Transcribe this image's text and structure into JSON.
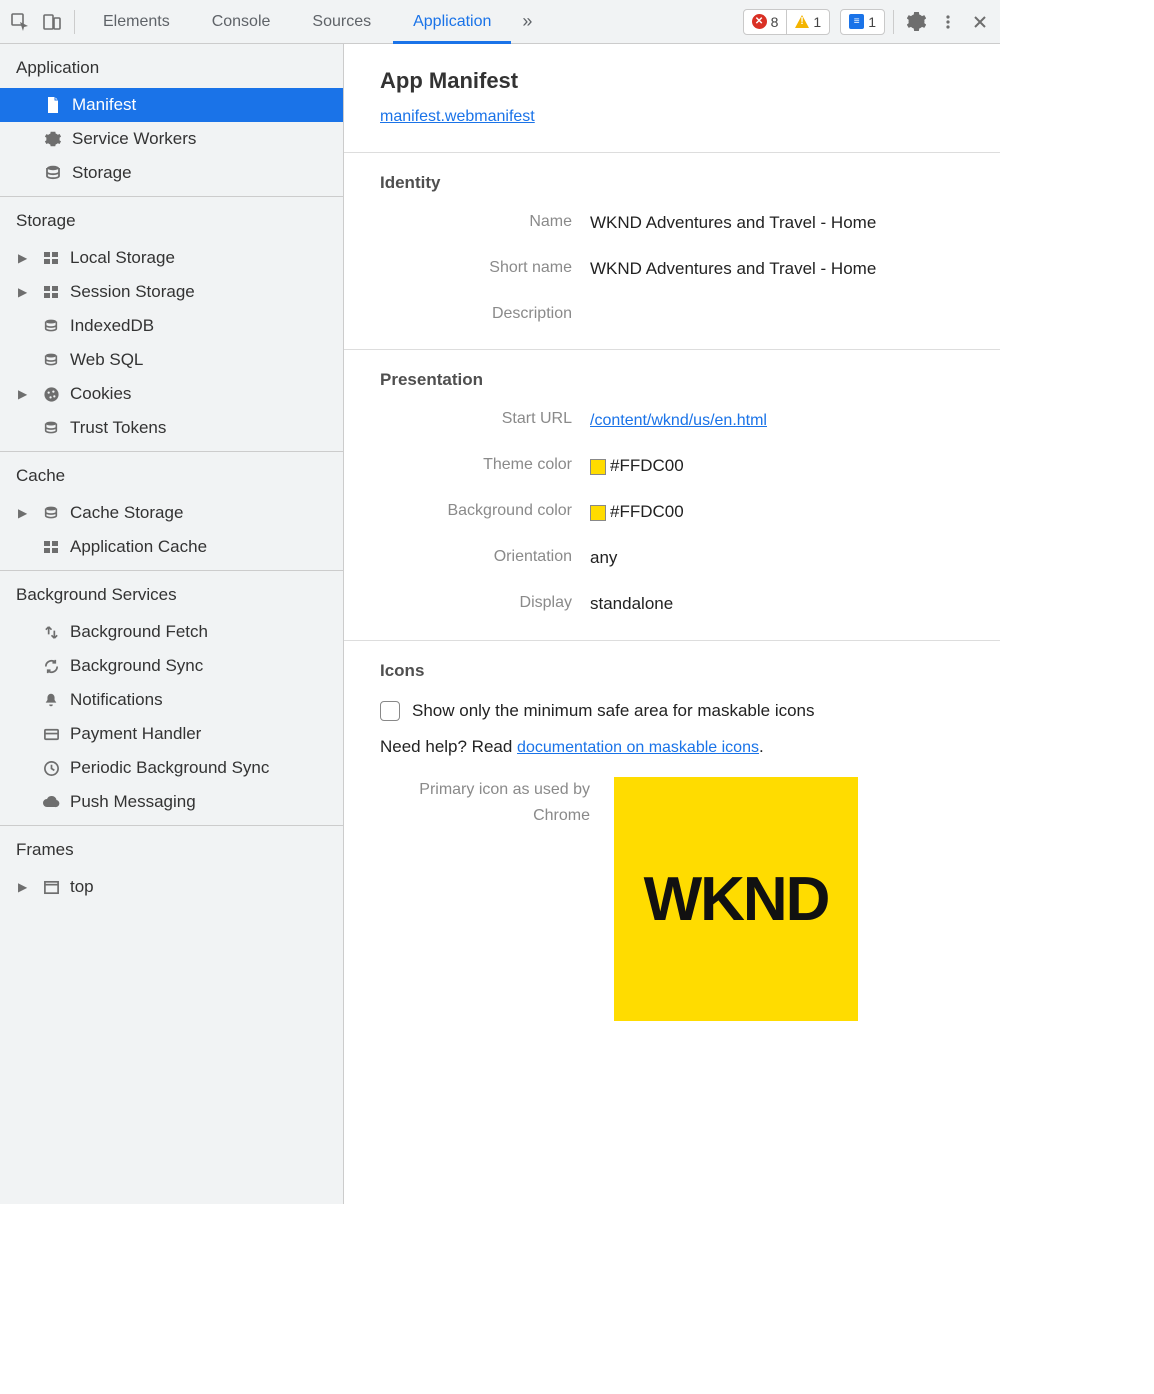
{
  "toolbar": {
    "tabs": [
      "Elements",
      "Console",
      "Sources",
      "Application"
    ],
    "active_tab_index": 3,
    "errors": "8",
    "warnings": "1",
    "messages": "1"
  },
  "sidebar": {
    "sections": [
      {
        "title": "Application",
        "items": [
          {
            "icon": "file",
            "label": "Manifest",
            "selected": true,
            "arrow": false
          },
          {
            "icon": "gear",
            "label": "Service Workers",
            "selected": false,
            "arrow": false
          },
          {
            "icon": "db",
            "label": "Storage",
            "selected": false,
            "arrow": false
          }
        ]
      },
      {
        "title": "Storage",
        "items": [
          {
            "icon": "grid",
            "label": "Local Storage",
            "arrow": true
          },
          {
            "icon": "grid",
            "label": "Session Storage",
            "arrow": true
          },
          {
            "icon": "db",
            "label": "IndexedDB",
            "arrow": false
          },
          {
            "icon": "db",
            "label": "Web SQL",
            "arrow": false
          },
          {
            "icon": "cookie",
            "label": "Cookies",
            "arrow": true
          },
          {
            "icon": "db",
            "label": "Trust Tokens",
            "arrow": false
          }
        ]
      },
      {
        "title": "Cache",
        "items": [
          {
            "icon": "db",
            "label": "Cache Storage",
            "arrow": true
          },
          {
            "icon": "grid",
            "label": "Application Cache",
            "arrow": false
          }
        ]
      },
      {
        "title": "Background Services",
        "items": [
          {
            "icon": "fetch",
            "label": "Background Fetch",
            "arrow": false
          },
          {
            "icon": "sync",
            "label": "Background Sync",
            "arrow": false
          },
          {
            "icon": "bell",
            "label": "Notifications",
            "arrow": false
          },
          {
            "icon": "card",
            "label": "Payment Handler",
            "arrow": false
          },
          {
            "icon": "clock",
            "label": "Periodic Background Sync",
            "arrow": false
          },
          {
            "icon": "cloud",
            "label": "Push Messaging",
            "arrow": false
          }
        ]
      },
      {
        "title": "Frames",
        "items": [
          {
            "icon": "frame",
            "label": "top",
            "arrow": true
          }
        ]
      }
    ]
  },
  "manifest": {
    "heading": "App Manifest",
    "file_link": "manifest.webmanifest",
    "identity": {
      "section": "Identity",
      "labels": {
        "name": "Name",
        "short_name": "Short name",
        "description": "Description"
      },
      "name": "WKND Adventures and Travel - Home",
      "short_name": "WKND Adventures and Travel - Home",
      "description": ""
    },
    "presentation": {
      "section": "Presentation",
      "labels": {
        "start_url": "Start URL",
        "theme_color": "Theme color",
        "background_color": "Background color",
        "orientation": "Orientation",
        "display": "Display"
      },
      "start_url": "/content/wknd/us/en.html",
      "theme_color": "#FFDC00",
      "background_color": "#FFDC00",
      "orientation": "any",
      "display": "standalone"
    },
    "icons": {
      "section": "Icons",
      "checkbox_label": "Show only the minimum safe area for maskable icons",
      "help_prefix": "Need help? Read ",
      "help_link": "documentation on maskable icons",
      "help_suffix": ".",
      "primary_label": "Primary icon as used by Chrome",
      "primary_text": "WKND"
    }
  }
}
